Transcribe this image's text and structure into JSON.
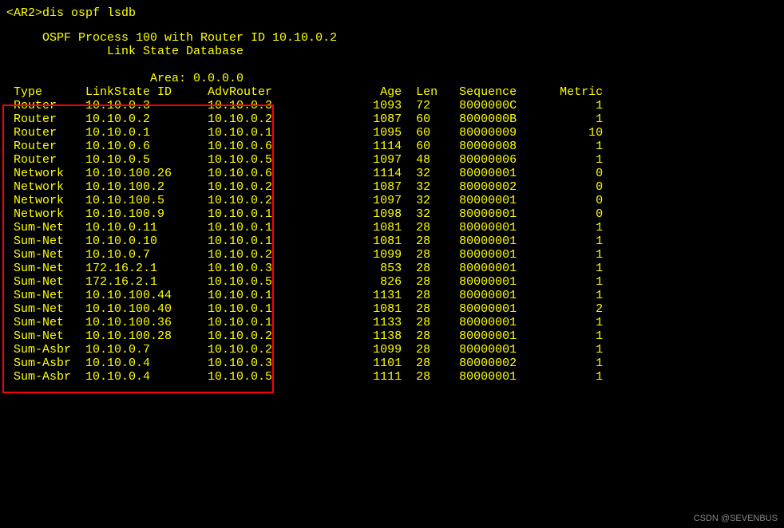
{
  "prompt": "<AR2>",
  "command": "dis ospf lsdb",
  "title_line": "     OSPF Process 100 with Router ID 10.10.0.2",
  "subtitle_line": "              Link State Database",
  "area_line": "                    Area: 0.0.0.0",
  "columns": {
    "type": "Type",
    "linkstate": "LinkState ID",
    "advrouter": "AdvRouter",
    "age": "Age",
    "len": "Len",
    "sequence": "Sequence",
    "metric": "Metric"
  },
  "rows": [
    {
      "type": "Router",
      "linkstate": "10.10.0.3",
      "advrouter": "10.10.0.3",
      "age": "1093",
      "len": "72",
      "sequence": "8000000C",
      "metric": "1"
    },
    {
      "type": "Router",
      "linkstate": "10.10.0.2",
      "advrouter": "10.10.0.2",
      "age": "1087",
      "len": "60",
      "sequence": "8000000B",
      "metric": "1"
    },
    {
      "type": "Router",
      "linkstate": "10.10.0.1",
      "advrouter": "10.10.0.1",
      "age": "1095",
      "len": "60",
      "sequence": "80000009",
      "metric": "10"
    },
    {
      "type": "Router",
      "linkstate": "10.10.0.6",
      "advrouter": "10.10.0.6",
      "age": "1114",
      "len": "60",
      "sequence": "80000008",
      "metric": "1"
    },
    {
      "type": "Router",
      "linkstate": "10.10.0.5",
      "advrouter": "10.10.0.5",
      "age": "1097",
      "len": "48",
      "sequence": "80000006",
      "metric": "1"
    },
    {
      "type": "Network",
      "linkstate": "10.10.100.26",
      "advrouter": "10.10.0.6",
      "age": "1114",
      "len": "32",
      "sequence": "80000001",
      "metric": "0"
    },
    {
      "type": "Network",
      "linkstate": "10.10.100.2",
      "advrouter": "10.10.0.2",
      "age": "1087",
      "len": "32",
      "sequence": "80000002",
      "metric": "0"
    },
    {
      "type": "Network",
      "linkstate": "10.10.100.5",
      "advrouter": "10.10.0.2",
      "age": "1097",
      "len": "32",
      "sequence": "80000001",
      "metric": "0"
    },
    {
      "type": "Network",
      "linkstate": "10.10.100.9",
      "advrouter": "10.10.0.1",
      "age": "1098",
      "len": "32",
      "sequence": "80000001",
      "metric": "0"
    },
    {
      "type": "Sum-Net",
      "linkstate": "10.10.0.11",
      "advrouter": "10.10.0.1",
      "age": "1081",
      "len": "28",
      "sequence": "80000001",
      "metric": "1"
    },
    {
      "type": "Sum-Net",
      "linkstate": "10.10.0.10",
      "advrouter": "10.10.0.1",
      "age": "1081",
      "len": "28",
      "sequence": "80000001",
      "metric": "1"
    },
    {
      "type": "Sum-Net",
      "linkstate": "10.10.0.7",
      "advrouter": "10.10.0.2",
      "age": "1099",
      "len": "28",
      "sequence": "80000001",
      "metric": "1"
    },
    {
      "type": "Sum-Net",
      "linkstate": "172.16.2.1",
      "advrouter": "10.10.0.3",
      "age": "853",
      "len": "28",
      "sequence": "80000001",
      "metric": "1"
    },
    {
      "type": "Sum-Net",
      "linkstate": "172.16.2.1",
      "advrouter": "10.10.0.5",
      "age": "826",
      "len": "28",
      "sequence": "80000001",
      "metric": "1"
    },
    {
      "type": "Sum-Net",
      "linkstate": "10.10.100.44",
      "advrouter": "10.10.0.1",
      "age": "1131",
      "len": "28",
      "sequence": "80000001",
      "metric": "1"
    },
    {
      "type": "Sum-Net",
      "linkstate": "10.10.100.40",
      "advrouter": "10.10.0.1",
      "age": "1081",
      "len": "28",
      "sequence": "80000001",
      "metric": "2"
    },
    {
      "type": "Sum-Net",
      "linkstate": "10.10.100.36",
      "advrouter": "10.10.0.1",
      "age": "1133",
      "len": "28",
      "sequence": "80000001",
      "metric": "1"
    },
    {
      "type": "Sum-Net",
      "linkstate": "10.10.100.28",
      "advrouter": "10.10.0.2",
      "age": "1138",
      "len": "28",
      "sequence": "80000001",
      "metric": "1"
    },
    {
      "type": "Sum-Asbr",
      "linkstate": "10.10.0.7",
      "advrouter": "10.10.0.2",
      "age": "1099",
      "len": "28",
      "sequence": "80000001",
      "metric": "1"
    },
    {
      "type": "Sum-Asbr",
      "linkstate": "10.10.0.4",
      "advrouter": "10.10.0.3",
      "age": "1101",
      "len": "28",
      "sequence": "80000002",
      "metric": "1"
    },
    {
      "type": "Sum-Asbr",
      "linkstate": "10.10.0.4",
      "advrouter": "10.10.0.5",
      "age": "1111",
      "len": "28",
      "sequence": "80000001",
      "metric": "1"
    }
  ],
  "watermark": "CSDN @SEVENBUS"
}
